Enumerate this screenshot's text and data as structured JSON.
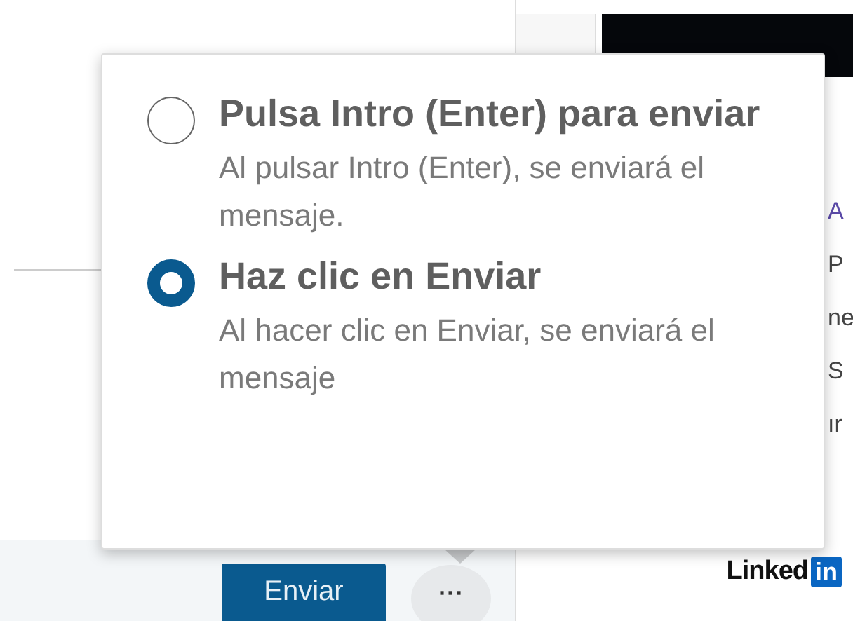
{
  "send_options": [
    {
      "title": "Pulsa Intro (Enter) para enviar",
      "description": "Al pulsar Intro (Enter), se enviará el mensaje.",
      "selected": false
    },
    {
      "title": "Haz clic en Enviar",
      "description": "Al hacer clic en Enviar, se enviará el mensaje",
      "selected": true
    }
  ],
  "send_button": "Enviar",
  "more_button": "···",
  "logo": {
    "text": "Linked",
    "badge": "in"
  },
  "background_fragments": [
    "A",
    "P",
    "ne",
    "S",
    "ır"
  ]
}
